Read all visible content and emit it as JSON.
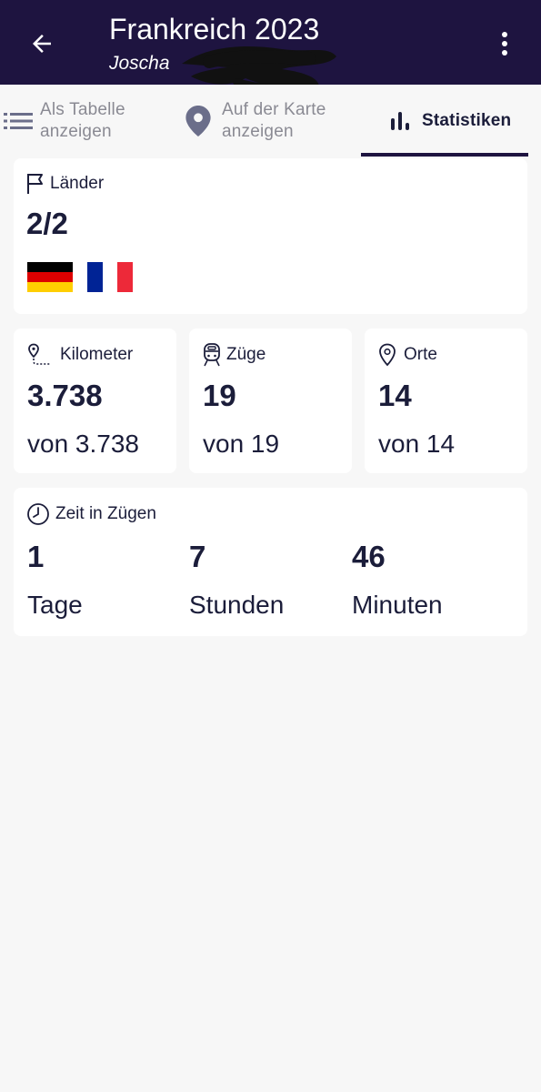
{
  "header": {
    "title": "Frankreich 2023",
    "subtitle": "Joscha",
    "back_icon": "arrow-left-icon",
    "menu_icon": "more-vert-icon"
  },
  "tabs": [
    {
      "label_line1": "Als Tabelle",
      "label_line2": "anzeigen",
      "icon": "list-icon",
      "active": false
    },
    {
      "label_line1": "Auf der Karte",
      "label_line2": "anzeigen",
      "icon": "map-pin-icon",
      "active": false
    },
    {
      "label_line1": "Statistiken",
      "label_line2": "",
      "icon": "bar-chart-icon",
      "active": true
    }
  ],
  "countries": {
    "label": "Länder",
    "value": "2/2",
    "flags": [
      "Deutschland",
      "Frankreich"
    ]
  },
  "stats": [
    {
      "label": "Kilometer",
      "value": "3.738",
      "total": "von 3.738",
      "icon": "route-icon"
    },
    {
      "label": "Züge",
      "value": "19",
      "total": "von 19",
      "icon": "train-icon"
    },
    {
      "label": "Orte",
      "value": "14",
      "total": "von 14",
      "icon": "location-icon"
    }
  ],
  "time": {
    "label": "Zeit in Zügen",
    "icon": "clock-icon",
    "days_value": "1",
    "days_label": "Tage",
    "hours_value": "7",
    "hours_label": "Stunden",
    "minutes_value": "46",
    "minutes_label": "Minuten"
  },
  "colors": {
    "appbar": "#1e1440",
    "text": "#1b1d3a",
    "inactive_tab": "#8a8a93",
    "background": "#f7f7f7"
  }
}
